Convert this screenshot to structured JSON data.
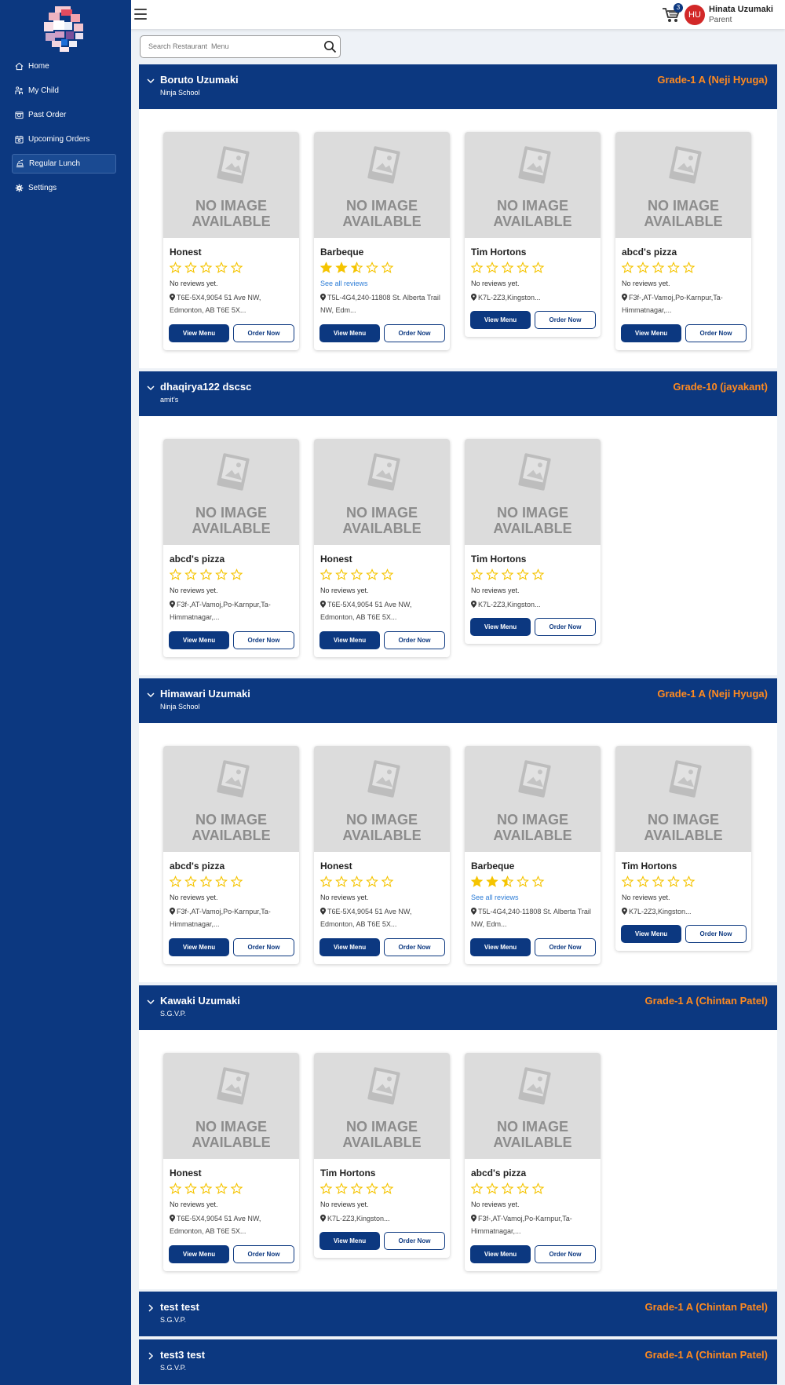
{
  "header": {
    "cart_count": "3",
    "avatar_initials": "HU",
    "user_name": "Hinata Uzumaki",
    "user_role": "Parent"
  },
  "sidebar": {
    "items": [
      {
        "label": "Home",
        "icon": "home-icon"
      },
      {
        "label": "My Child",
        "icon": "child-icon"
      },
      {
        "label": "Past Order",
        "icon": "past-order-icon"
      },
      {
        "label": "Upcoming Orders",
        "icon": "calendar-icon"
      },
      {
        "label": "Regular Lunch",
        "icon": "lunch-icon",
        "active": true
      },
      {
        "label": "Settings",
        "icon": "gear-icon"
      }
    ]
  },
  "search": {
    "placeholder": "Search Restaurant  Menu"
  },
  "card_labels": {
    "no_image": "NO IMAGE AVAILABLE",
    "view_menu": "View Menu",
    "order_now": "Order Now"
  },
  "colors": {
    "primary": "#0c3880",
    "grade": "#ff8a1f",
    "star": "#f5c400",
    "link": "#2c7cd6",
    "avatar": "#d22828"
  },
  "groups": [
    {
      "name": "Boruto Uzumaki",
      "school": "Ninja School",
      "grade": "Grade-1 A (Neji Hyuga)",
      "expanded": true,
      "restaurants": [
        {
          "name": "Honest",
          "rating": 0,
          "reviews": "No reviews yet.",
          "address": "T6E-5X4,9054 51 Ave NW, Edmonton, AB T6E 5X..."
        },
        {
          "name": "Barbeque",
          "rating": 2.5,
          "reviews": "See all reviews",
          "address": "T5L-4G4,240-11808 St. Alberta Trail NW, Edm..."
        },
        {
          "name": "Tim Hortons",
          "rating": 0,
          "reviews": "No reviews yet.",
          "address": "K7L-2Z3,Kingston..."
        },
        {
          "name": "abcd's pizza",
          "rating": 0,
          "reviews": "No reviews yet.",
          "address": "F3f-,AT-Vamoj,Po-Karnpur,Ta-Himmatnagar,..."
        }
      ]
    },
    {
      "name": "dhaqirya122 dscsc",
      "school": "amit's",
      "grade": "Grade-10 (jayakant)",
      "expanded": true,
      "restaurants": [
        {
          "name": "abcd's pizza",
          "rating": 0,
          "reviews": "No reviews yet.",
          "address": "F3f-,AT-Vamoj,Po-Karnpur,Ta-Himmatnagar,..."
        },
        {
          "name": "Honest",
          "rating": 0,
          "reviews": "No reviews yet.",
          "address": "T6E-5X4,9054 51 Ave NW, Edmonton, AB T6E 5X..."
        },
        {
          "name": "Tim Hortons",
          "rating": 0,
          "reviews": "No reviews yet.",
          "address": "K7L-2Z3,Kingston..."
        }
      ]
    },
    {
      "name": "Himawari Uzumaki",
      "school": "Ninja School",
      "grade": "Grade-1 A (Neji Hyuga)",
      "expanded": true,
      "restaurants": [
        {
          "name": "abcd's pizza",
          "rating": 0,
          "reviews": "No reviews yet.",
          "address": "F3f-,AT-Vamoj,Po-Karnpur,Ta-Himmatnagar,..."
        },
        {
          "name": "Honest",
          "rating": 0,
          "reviews": "No reviews yet.",
          "address": "T6E-5X4,9054 51 Ave NW, Edmonton, AB T6E 5X..."
        },
        {
          "name": "Barbeque",
          "rating": 2.5,
          "reviews": "See all reviews",
          "address": "T5L-4G4,240-11808 St. Alberta Trail NW, Edm..."
        },
        {
          "name": "Tim Hortons",
          "rating": 0,
          "reviews": "No reviews yet.",
          "address": "K7L-2Z3,Kingston..."
        }
      ]
    },
    {
      "name": "Kawaki Uzumaki",
      "school": "S.G.V.P.",
      "grade": "Grade-1 A (Chintan Patel)",
      "expanded": true,
      "restaurants": [
        {
          "name": "Honest",
          "rating": 0,
          "reviews": "No reviews yet.",
          "address": "T6E-5X4,9054 51 Ave NW, Edmonton, AB T6E 5X..."
        },
        {
          "name": "Tim Hortons",
          "rating": 0,
          "reviews": "No reviews yet.",
          "address": "K7L-2Z3,Kingston..."
        },
        {
          "name": "abcd's pizza",
          "rating": 0,
          "reviews": "No reviews yet.",
          "address": "F3f-,AT-Vamoj,Po-Karnpur,Ta-Himmatnagar,..."
        }
      ]
    },
    {
      "name": "test test",
      "school": "S.G.V.P.",
      "grade": "Grade-1 A (Chintan Patel)",
      "expanded": false,
      "restaurants": []
    },
    {
      "name": "test3 test",
      "school": "S.G.V.P.",
      "grade": "Grade-1 A (Chintan Patel)",
      "expanded": false,
      "restaurants": []
    }
  ]
}
